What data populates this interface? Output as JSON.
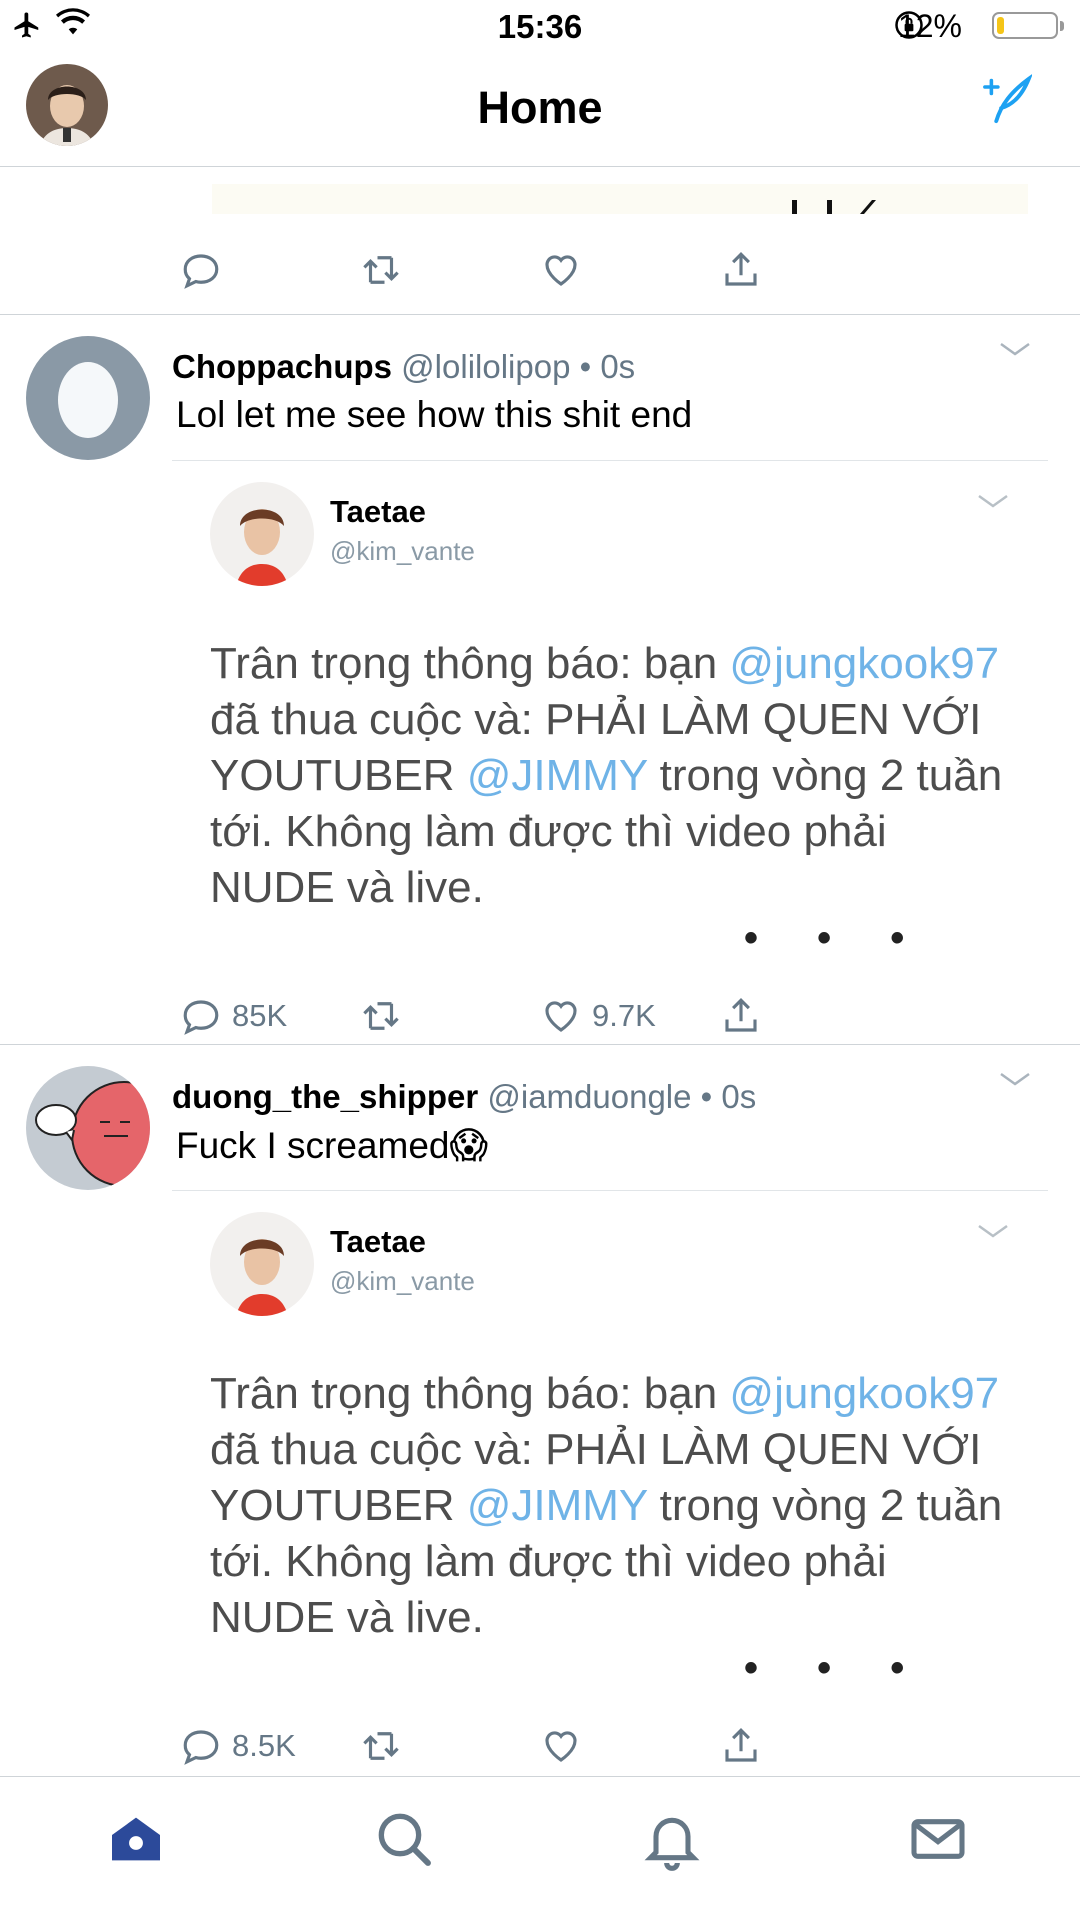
{
  "status_bar": {
    "time": "15:36",
    "battery_pct": "12%",
    "battery_level": 0.12,
    "battery_color": "#f5c518"
  },
  "header": {
    "title": "Home"
  },
  "colors": {
    "accent": "#1da1f2",
    "muted": "#657786",
    "mention": "#6fb3e7",
    "tab_active": "#2c4a9a"
  },
  "timeline": {
    "tweets": [
      {
        "name": "Choppachups",
        "handle": "@lolilolipop",
        "time": "• 0s",
        "text": "Lol let me see how this shit end",
        "quoted": {
          "name": "Taetae",
          "handle": "@kim_vante",
          "lines": [
            [
              "Trân trọng thông báo: bạn ",
              "@jungkook97"
            ],
            [
              "đã thua cuộc và: PHẢI LÀM QUEN VỚI"
            ],
            [
              "YOUTUBER ",
              "@JIMMY",
              " trong vòng 2 tuần"
            ],
            [
              "tới. Không làm được thì video phải"
            ],
            [
              "NUDE và live."
            ]
          ],
          "more": "• • •"
        },
        "reply_count": "85K",
        "like_count": "9.7K"
      },
      {
        "name": "duong_the_shipper",
        "handle": "@iamduongle",
        "time": "• 0s",
        "text": "Fuck I screamed😱",
        "quoted": {
          "name": "Taetae",
          "handle": "@kim_vante",
          "lines": [
            [
              "Trân trọng thông báo: bạn ",
              "@jungkook97"
            ],
            [
              "đã thua cuộc và: PHẢI LÀM QUEN VỚI"
            ],
            [
              "YOUTUBER ",
              "@JIMMY",
              " trong vòng 2 tuần"
            ],
            [
              "tới. Không làm được thì video phải"
            ],
            [
              "NUDE và live."
            ]
          ],
          "more": "• • •"
        },
        "reply_count": "8.5K",
        "like_count": ""
      }
    ]
  },
  "tabs": [
    {
      "name": "home-icon",
      "active": true
    },
    {
      "name": "search-icon",
      "active": false
    },
    {
      "name": "bell-icon",
      "active": false
    },
    {
      "name": "mail-icon",
      "active": false
    }
  ]
}
